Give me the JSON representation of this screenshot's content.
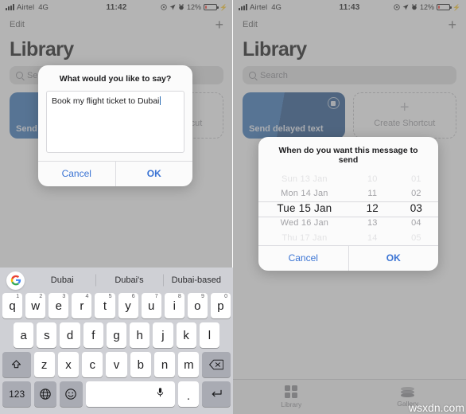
{
  "left": {
    "status": {
      "carrier": "Airtel",
      "network": "4G",
      "time": "11:42",
      "battery_pct": "12%",
      "icons": [
        "signal-bars-icon",
        "location-arrow-icon",
        "alarm-icon",
        "battery-icon",
        "bolt-icon"
      ]
    },
    "nav": {
      "edit": "Edit",
      "add": "+"
    },
    "title": "Library",
    "search": {
      "placeholder": "Search"
    },
    "cards": [
      {
        "label": "Send delayed text",
        "type": "filled"
      },
      {
        "label": "Create Shortcut",
        "type": "empty"
      }
    ],
    "dialog": {
      "title": "What would you like to say?",
      "text": "Book my flight ticket to Dubai",
      "cancel": "Cancel",
      "ok": "OK"
    },
    "keyboard": {
      "suggestions": [
        "Dubai",
        "Dubai's",
        "Dubai-based"
      ],
      "row1": [
        {
          "k": "q",
          "n": "1"
        },
        {
          "k": "w",
          "n": "2"
        },
        {
          "k": "e",
          "n": "3"
        },
        {
          "k": "r",
          "n": "4"
        },
        {
          "k": "t",
          "n": "5"
        },
        {
          "k": "y",
          "n": "6"
        },
        {
          "k": "u",
          "n": "7"
        },
        {
          "k": "i",
          "n": "8"
        },
        {
          "k": "o",
          "n": "9"
        },
        {
          "k": "p",
          "n": "0"
        }
      ],
      "row2": [
        "a",
        "s",
        "d",
        "f",
        "g",
        "h",
        "j",
        "k",
        "l"
      ],
      "row3": [
        "z",
        "x",
        "c",
        "v",
        "b",
        "n",
        "m"
      ],
      "shift": "shift-icon",
      "backspace": "backspace-icon",
      "numeric": "123",
      "globe": "globe-icon",
      "emoji": "emoji-icon",
      "space": "",
      "mic": "mic-icon",
      "period": ".",
      "enter": "return-icon"
    }
  },
  "right": {
    "status": {
      "carrier": "Airtel",
      "network": "4G",
      "time": "11:43",
      "battery_pct": "12%"
    },
    "nav": {
      "edit": "Edit",
      "add": "+"
    },
    "title": "Library",
    "search": {
      "placeholder": "Search"
    },
    "cards": [
      {
        "label": "Send delayed text",
        "type": "filled"
      },
      {
        "label": "Create Shortcut",
        "type": "empty"
      }
    ],
    "tabs": [
      {
        "label": "Library",
        "icon": "grid-icon"
      },
      {
        "label": "Gallery",
        "icon": "stack-icon"
      }
    ],
    "dialog": {
      "title": "When do you want this message to send",
      "cancel": "Cancel",
      "ok": "OK",
      "picker": {
        "day": [
          "Sun 13 Jan",
          "Mon 14 Jan",
          "Tue 15 Jan",
          "Wed 16 Jan",
          "Thu 17 Jan"
        ],
        "hour": [
          "10",
          "11",
          "12",
          "13",
          "14"
        ],
        "minute": [
          "01",
          "02",
          "03",
          "04",
          "05"
        ],
        "selected_index": 2,
        "selected": {
          "day": "Tue 15 Jan",
          "hour": "12",
          "minute": "03"
        }
      }
    }
  },
  "watermark": "wsxdn.com",
  "colors": {
    "accent_blue": "#3b74d4",
    "card_blue": "#2f6fb5",
    "battery_red": "#ff3b30",
    "dim": "rgba(120,120,120,0.55)"
  }
}
